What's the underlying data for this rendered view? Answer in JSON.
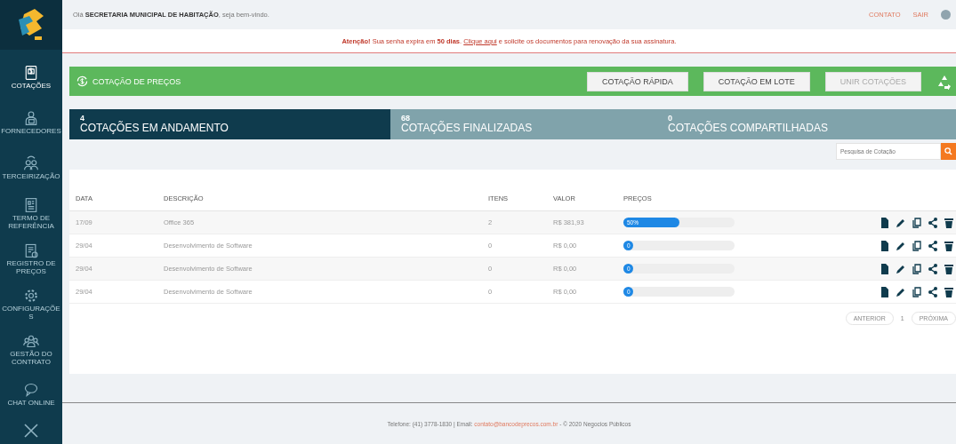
{
  "header": {
    "greeting": "Olá **SECRETARIA MUNICIPAL DE HABITAÇÃO**, seja bem-vindo.",
    "links": [
      "CONTATO",
      "SAIR"
    ]
  },
  "alert": {
    "before": "**Atenção!** Sua senha expira em **50 dias**.",
    "link": "Clique aqui",
    "after": "e solicite os documentos para renovação da sua assinatura."
  },
  "sidebar": {
    "items": [
      {
        "label": "COTAÇÕES",
        "kind": "quote",
        "selected": true
      },
      {
        "label": "FORNECEDORES",
        "kind": "supplier",
        "selected": false
      },
      {
        "label": "TERCEIRIZAÇÃO",
        "kind": "people",
        "selected": false
      },
      {
        "label": "TERMO DE REFERÊNCIA",
        "kind": "document",
        "selected": false
      },
      {
        "label": "REGISTRO DE PREÇOS",
        "kind": "register",
        "selected": false
      },
      {
        "label": "CONFIGURAÇÕES",
        "kind": "gear",
        "selected": false
      },
      {
        "label": "GESTÃO DO CONTRATO",
        "kind": "group",
        "selected": false
      },
      {
        "label": "CHAT ONLINE",
        "kind": "chat",
        "selected": false
      }
    ]
  },
  "toolbar": {
    "title": "COTAÇÃO DE PREÇOS",
    "buttons": [
      {
        "label": "COTAÇÃO RÁPIDA",
        "disabled": false
      },
      {
        "label": "COTAÇÃO EM LOTE",
        "disabled": false
      },
      {
        "label": "UNIR COTAÇÕES",
        "disabled": true
      }
    ]
  },
  "tabs": [
    {
      "count": "4",
      "label": "COTAÇÕES EM ANDAMENTO",
      "selected": true
    },
    {
      "count": "68",
      "label": "COTAÇÕES FINALIZADAS",
      "selected": false
    },
    {
      "count": "0",
      "label": "COTAÇÕES COMPARTILHADAS",
      "selected": false
    }
  ],
  "search": {
    "placeholder": "Pesquisa de Cotação"
  },
  "table": {
    "columns": [
      "DATA",
      "DESCRIÇÃO",
      "ITENS",
      "VALOR",
      "PREÇOS"
    ],
    "rows": [
      {
        "date": "17/09",
        "description": "Office 365",
        "items": "2",
        "value": "R$ 381,93",
        "level": 0.5,
        "progress_label": "50%"
      },
      {
        "date": "29/04",
        "description": "Desenvolvimento de Software",
        "items": "0",
        "value": "R$ 0,00",
        "level": 0,
        "progress_label": "0"
      },
      {
        "date": "29/04",
        "description": "Desenvolvimento de Software",
        "items": "0",
        "value": "R$ 0,00",
        "level": 0,
        "progress_label": "0"
      },
      {
        "date": "29/04",
        "description": "Desenvolvimento de Software",
        "items": "0",
        "value": "R$ 0,00",
        "level": 0,
        "progress_label": "0"
      }
    ]
  },
  "pagination": {
    "previous": "ANTERIOR",
    "page": "1",
    "next": "PRÓXIMA"
  },
  "footer": {
    "before": "Telefone: (41) 3778-1830 | Email:",
    "link": "contato@bancodeprecos.com.br",
    "after": "- © 2020 Negocios Públicos"
  }
}
